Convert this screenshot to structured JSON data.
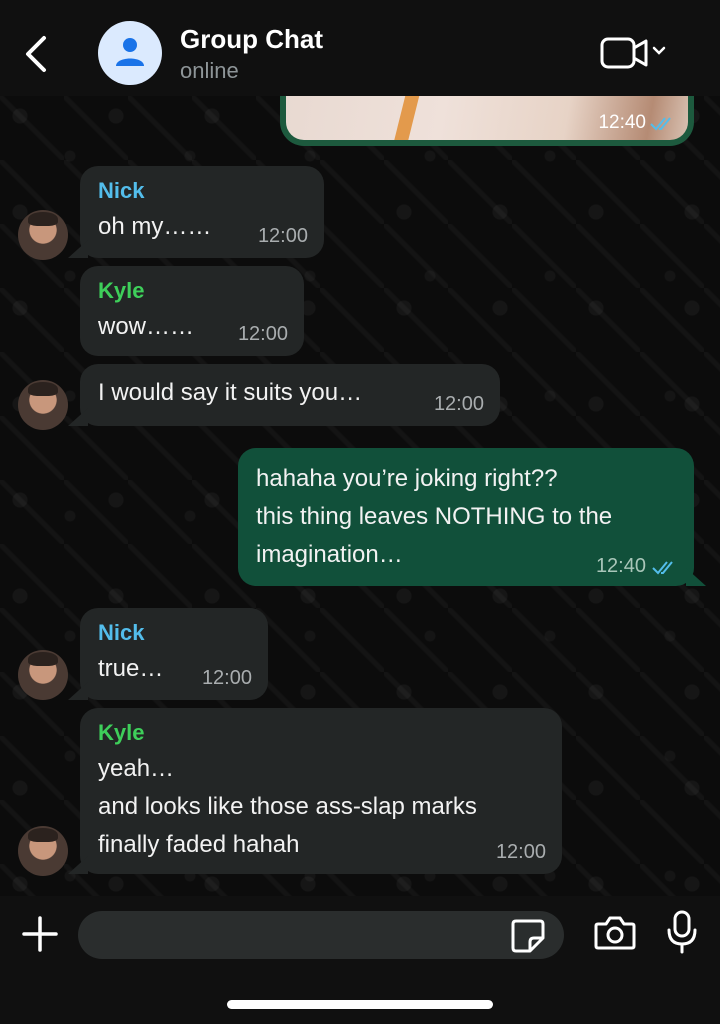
{
  "header": {
    "title": "Group Chat",
    "status": "online"
  },
  "image_message": {
    "time": "12:40"
  },
  "messages": [
    {
      "sender": "Nick",
      "text": "oh my……",
      "time": "12:00"
    },
    {
      "sender": "Kyle",
      "text": "wow……",
      "time": "12:00"
    },
    {
      "sender": "",
      "text": "I would say it suits you…",
      "time": "12:00"
    },
    {
      "sender": "",
      "text": "hahaha you’re joking right??\nthis thing leaves NOTHING to the\nimagination…",
      "time": "12:40"
    },
    {
      "sender": "Nick",
      "text": "true…",
      "time": "12:00"
    },
    {
      "sender": "Kyle",
      "text": "yeah…\nand looks like those ass-slap marks\nfinally faded hahah",
      "time": "12:00"
    }
  ],
  "input": {
    "placeholder": "",
    "value": ""
  },
  "icons": {
    "back": "chevron-left-icon",
    "video": "video-camera-icon",
    "plus": "plus-icon",
    "sticker": "sticker-icon",
    "camera": "camera-icon",
    "mic": "microphone-icon"
  },
  "colors": {
    "outgoing_bubble": "#11503a",
    "incoming_bubble": "#232626",
    "nick_name": "#53bdeb",
    "kyle_name": "#3ecf5a",
    "read_ticks": "#53bdeb"
  }
}
